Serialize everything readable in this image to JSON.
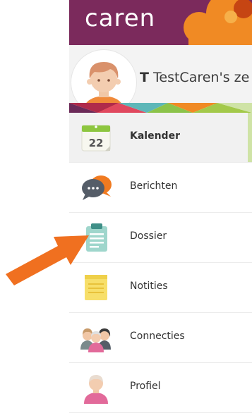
{
  "app": {
    "logo_text": "caren"
  },
  "profile": {
    "initial": "T",
    "name_visible": "TestCaren's ze"
  },
  "menu": {
    "items": [
      {
        "label": "Kalender",
        "icon": "calendar-icon",
        "calendar_day": "22",
        "active": true
      },
      {
        "label": "Berichten",
        "icon": "chat-bubbles-icon",
        "active": false
      },
      {
        "label": "Dossier",
        "icon": "clipboard-icon",
        "active": false
      },
      {
        "label": "Notities",
        "icon": "notepad-icon",
        "active": false
      },
      {
        "label": "Connecties",
        "icon": "people-group-icon",
        "active": false
      },
      {
        "label": "Profiel",
        "icon": "user-profile-icon",
        "active": false
      }
    ]
  },
  "colors": {
    "header": "#7b2a5c",
    "accent_orange": "#f08a24",
    "arrow": "#f07020",
    "active_strip": "#cfe3a6"
  }
}
